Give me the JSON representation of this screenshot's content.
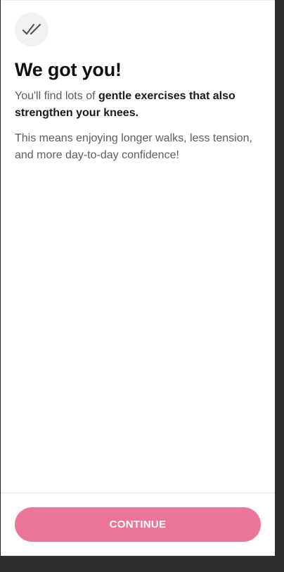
{
  "icon": {
    "name": "double-check-icon"
  },
  "content": {
    "title": "We got you!",
    "intro_prefix": "You'll find lots of ",
    "intro_bold": "gentle exercises that also strengthen your knees.",
    "body": "This means enjoying longer walks, less tension, and more day-to-day confidence!"
  },
  "actions": {
    "continue_label": "CONTINUE"
  },
  "colors": {
    "accent": "#ec7699",
    "background": "#ffffff",
    "outer_background": "#2f2f2f",
    "title_text": "#111111",
    "body_text": "#5d5d5d"
  }
}
